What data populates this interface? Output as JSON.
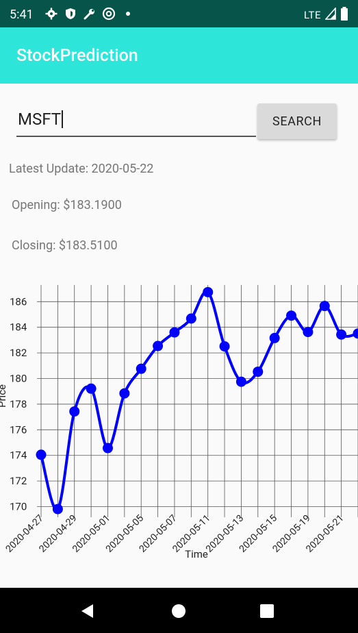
{
  "status_bar": {
    "time": "5:41",
    "network": "LTE",
    "left_icons": [
      "gear-icon",
      "shield-icon",
      "wrench-icon",
      "at-icon",
      "dot-icon"
    ],
    "right_icons": [
      "signal-icon",
      "battery-icon"
    ]
  },
  "app_bar": {
    "title": "StockPrediction",
    "color": "#2de6d9"
  },
  "search": {
    "value": "MSFT",
    "button_label": "SEARCH"
  },
  "info": {
    "latest_update": "Latest Update: 2020-05-22",
    "opening": "Opening: $183.1900",
    "closing": "Closing: $183.5100"
  },
  "chart_data": {
    "type": "line",
    "xlabel": "Time",
    "ylabel": "Price",
    "x_tick_labels": [
      "2020-04-27",
      "2020-04-29",
      "2020-05-01",
      "2020-05-05",
      "2020-05-07",
      "2020-05-11",
      "2020-05-13",
      "2020-05-15",
      "2020-05-19",
      "2020-05-21"
    ],
    "y_ticks": [
      170,
      172,
      174,
      176,
      178,
      180,
      182,
      184,
      186
    ],
    "ylim": [
      169.6,
      187.3
    ],
    "grid": true,
    "line_color": "#0000ff",
    "series": [
      {
        "x": [
          "2020-04-27",
          "2020-04-28",
          "2020-04-29",
          "2020-04-30",
          "2020-05-01",
          "2020-05-04",
          "2020-05-05",
          "2020-05-06",
          "2020-05-07",
          "2020-05-08",
          "2020-05-11",
          "2020-05-12",
          "2020-05-13",
          "2020-05-14",
          "2020-05-15",
          "2020-05-18",
          "2020-05-19",
          "2020-05-20",
          "2020-05-21",
          "2020-05-22"
        ],
        "values": [
          174.05,
          169.81,
          177.43,
          179.21,
          174.57,
          178.84,
          180.76,
          182.54,
          183.6,
          184.68,
          186.74,
          182.51,
          179.75,
          180.53,
          183.16,
          184.91,
          183.63,
          185.66,
          183.43,
          183.51
        ]
      }
    ]
  },
  "nav_bar": {
    "icons": [
      "back-icon",
      "home-icon",
      "recents-icon"
    ]
  }
}
